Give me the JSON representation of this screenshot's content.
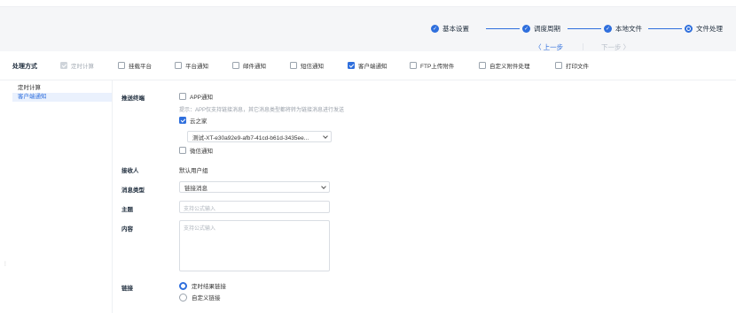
{
  "steps": [
    {
      "label": "基本设置",
      "state": "done"
    },
    {
      "label": "调度周期",
      "state": "done"
    },
    {
      "label": "本地文件",
      "state": "done"
    },
    {
      "label": "文件处理",
      "state": "current"
    }
  ],
  "nav": {
    "prev": "〈 上一步",
    "next": "下一步 〉"
  },
  "methods": {
    "label": "处理方式",
    "items": [
      {
        "label": "定时计算",
        "checked": true,
        "disabled": true
      },
      {
        "label": "挂载平台",
        "checked": false
      },
      {
        "label": "平台通知",
        "checked": false
      },
      {
        "label": "邮件通知",
        "checked": false
      },
      {
        "label": "短信通知",
        "checked": false
      },
      {
        "label": "客户端通知",
        "checked": true
      },
      {
        "label": "FTP上传附件",
        "checked": false
      },
      {
        "label": "自定义附件处理",
        "checked": false
      },
      {
        "label": "打印文件",
        "checked": false
      }
    ]
  },
  "sidebar": {
    "items": [
      {
        "label": "定时计算",
        "active": false
      },
      {
        "label": "客户端通知",
        "active": true
      }
    ]
  },
  "form": {
    "push_label": "推送终端",
    "app_label": "APP通知",
    "app_hint": "提示：APP仅支持链接消息，其它消息类型都将转为链接消息进行发送",
    "cloud_label": "云之家",
    "cloud_select": "测试-XT-e30a92e9-afb7-41cd-b61d-3435ee...",
    "wechat_label": "微信通知",
    "receiver_label": "接收人",
    "receiver_value": "默认用户组",
    "msgtype_label": "消息类型",
    "msgtype_value": "链接消息",
    "subject_label": "主题",
    "subject_placeholder": "支持公式输入",
    "content_label": "内容",
    "content_placeholder": "支持公式输入",
    "link_label": "链接",
    "link_options": [
      {
        "label": "定时结果链接",
        "selected": true
      },
      {
        "label": "自定义链接",
        "selected": false
      }
    ]
  },
  "colors": {
    "accent": "#2f6fdd"
  }
}
